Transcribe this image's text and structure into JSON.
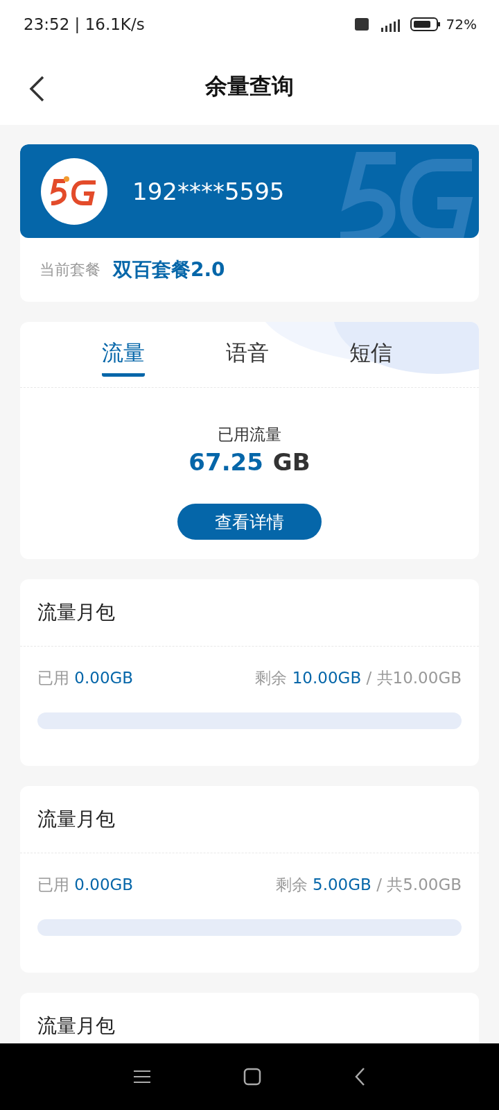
{
  "status_bar": {
    "time": "23:52 | 16.1K/s",
    "battery": "72%"
  },
  "header": {
    "title": "余量查询"
  },
  "account": {
    "phone": "192****5595",
    "plan_label": "当前套餐",
    "plan_name": "双百套餐2.0"
  },
  "tabs": [
    {
      "label": "流量",
      "selected": true
    },
    {
      "label": "语音",
      "selected": false
    },
    {
      "label": "短信",
      "selected": false
    }
  ],
  "usage": {
    "label": "已用流量",
    "value": "67.25",
    "unit": "GB",
    "button": "查看详情"
  },
  "packages": [
    {
      "title": "流量月包",
      "used_label": "已用",
      "used": "0.00GB",
      "remain_label": "剩余",
      "remain": "10.00GB",
      "total": "/ 共10.00GB",
      "level": 0
    },
    {
      "title": "流量月包",
      "used_label": "已用",
      "used": "0.00GB",
      "remain_label": "剩余",
      "remain": "5.00GB",
      "total": "/ 共5.00GB",
      "level": 0
    },
    {
      "title": "流量月包"
    }
  ]
}
